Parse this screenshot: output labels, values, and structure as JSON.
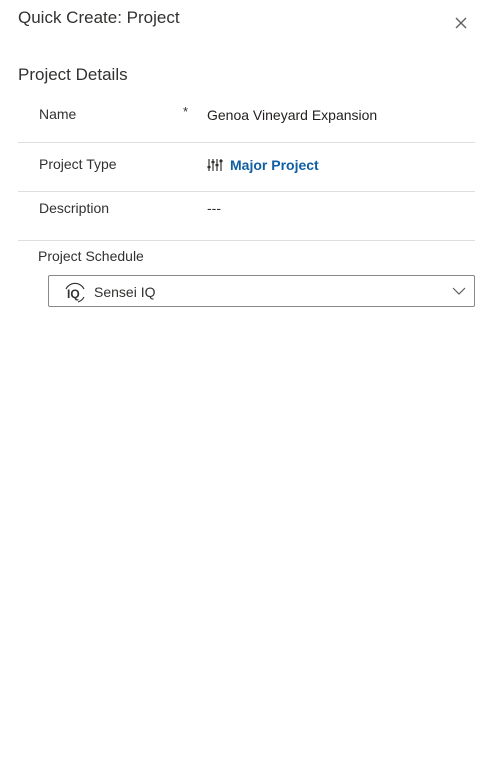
{
  "dialog": {
    "title": "Quick Create: Project"
  },
  "section": {
    "title": "Project Details"
  },
  "fields": {
    "name": {
      "label": "Name",
      "required_mark": "*",
      "value": "Genoa Vineyard Expansion"
    },
    "project_type": {
      "label": "Project Type",
      "icon": "sliders-icon",
      "value": "Major Project"
    },
    "description": {
      "label": "Description",
      "value": "---"
    }
  },
  "schedule": {
    "label": "Project Schedule",
    "icon": "iq-logo-icon",
    "selected": "Sensei IQ"
  },
  "colors": {
    "link": "#115ea3",
    "divider": "#e1dfdd",
    "text": "#323130"
  }
}
